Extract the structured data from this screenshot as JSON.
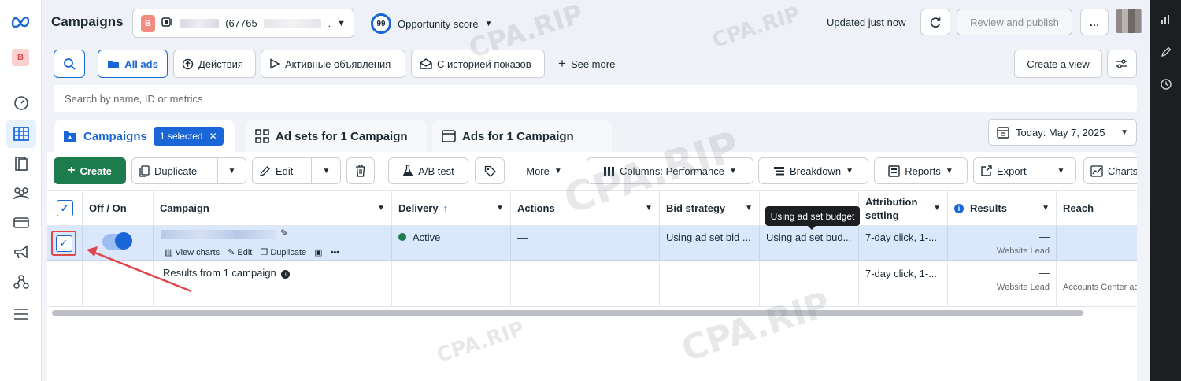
{
  "header": {
    "title": "Campaigns",
    "account_badge": "B",
    "account_id": "(67765",
    "account_suffix": ".",
    "opportunity_score_value": "99",
    "opportunity_score_label": "Opportunity score",
    "updated": "Updated just now",
    "review_publish": "Review and publish",
    "more": "…"
  },
  "leftnav": {
    "avatar": "B"
  },
  "filters": {
    "all_ads": "All ads",
    "actions": "Действия",
    "active_ads": "Активные объявления",
    "with_history": "С историей показов",
    "see_more": "See more",
    "create_view": "Create a view"
  },
  "search": {
    "placeholder": "Search by name, ID or metrics"
  },
  "tabs": {
    "campaigns": "Campaigns",
    "selected": "1 selected",
    "adsets": "Ad sets for 1 Campaign",
    "ads": "Ads for 1 Campaign",
    "date": "Today: May 7, 2025"
  },
  "toolbar": {
    "create": "Create",
    "duplicate": "Duplicate",
    "edit": "Edit",
    "ab_test": "A/B test",
    "more": "More",
    "columns": "Columns: Performance",
    "breakdown": "Breakdown",
    "reports": "Reports",
    "export": "Export",
    "charts": "Charts"
  },
  "table": {
    "headers": {
      "off_on": "Off / On",
      "campaign": "Campaign",
      "delivery": "Delivery",
      "actions": "Actions",
      "bid_strategy": "Bid strategy",
      "attribution": "Attribution setting",
      "results": "Results",
      "reach": "Reach"
    },
    "row": {
      "view_charts": "View charts",
      "edit": "Edit",
      "duplicate": "Duplicate",
      "delivery": "Active",
      "actions": "—",
      "bid_strategy": "Using ad set bid ...",
      "budget": "Using ad set bud...",
      "attribution": "7-day click, 1-...",
      "results_value": "—",
      "results_sub": "Website Lead"
    },
    "summary": {
      "label": "Results from 1 campaign",
      "attribution": "7-day click, 1-...",
      "results_value": "—",
      "results_sub": "Website Lead",
      "reach": "Accounts Center acc"
    },
    "tooltip": "Using ad set budget"
  },
  "watermark": "CPA.RIP",
  "colors": {
    "accent": "#1a66d6",
    "create": "#1e7b4d",
    "highlight": "#e0474d",
    "selected_row": "#dbe7fb"
  }
}
